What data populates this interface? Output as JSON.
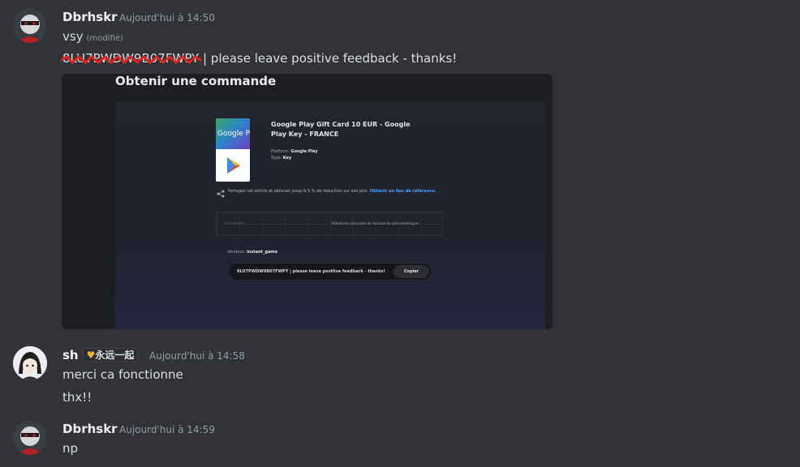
{
  "messages": [
    {
      "username": "Dbrhskr",
      "timestamp": "Aujourd'hui à 14:50",
      "line1": "vsy",
      "edited": "(modifié)",
      "line2_code": "8LU7PWDW9B07FWPY",
      "line2_rest": " | please leave positive feedback - thanks!"
    },
    {
      "username": "sh",
      "badge": "永远一起",
      "timestamp": "Aujourd'hui à 14:58",
      "line1": "merci ca fonctionne",
      "line2": "thx!!"
    },
    {
      "username": "Dbrhskr",
      "timestamp": "Aujourd'hui à 14:59",
      "line1": "np"
    }
  ],
  "embed": {
    "title": "Obtenir une commande",
    "card_logo": "Google Play",
    "product_title": "Google Play Gift Card 10 EUR - Google Play Key - FRANCE",
    "platform_label": "Platform:",
    "platform_value": "Google Play",
    "type_label": "Type:",
    "type_value": "Key",
    "share_text": "Partagez cet article et obtenez jusqu'à 5 % de réduction sur son prix.",
    "share_link": "Obtenir un lien de référence.",
    "grid_left": "Sellsthere",
    "grid_right": "Plateforme sécurisée de livraison de clés numériques",
    "seller_label": "Vendeur:",
    "seller_value": "instant_game",
    "key_text": "8LU7PWDW9B07FWPY | please leave positive feedback - thanks!",
    "copy_label": "Copier"
  }
}
